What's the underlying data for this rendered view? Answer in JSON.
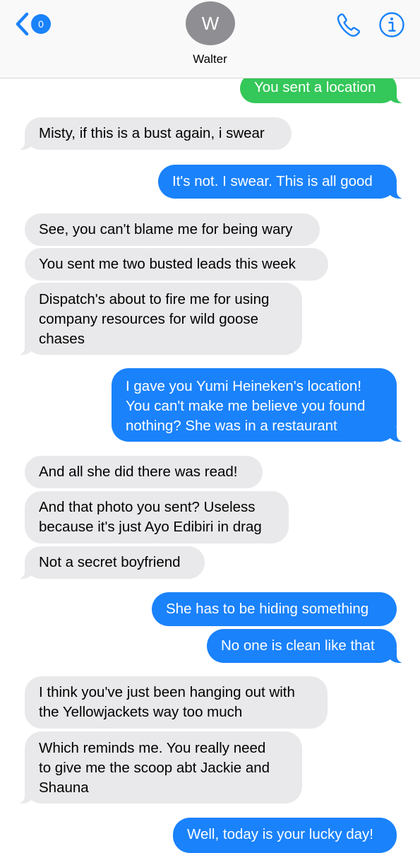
{
  "header": {
    "unread_count": "0",
    "avatar_initial": "W",
    "contact_name": "Walter",
    "back_icon": "chevron-left-icon",
    "call_icon": "phone-icon",
    "info_icon": "info-circle-icon"
  },
  "colors": {
    "accent": "#1a82fb",
    "sent_bubble": "#1a82fb",
    "received_bubble": "#e9e9eb",
    "location_bubble": "#34c759",
    "avatar": "#8e8e93"
  },
  "messages": [
    {
      "sender": "me",
      "text": "You sent a location"
    },
    {
      "sender": "walter",
      "text": "Misty, if this is a bust again, i swear"
    },
    {
      "sender": "me",
      "text": "It's not. I swear. This is all good"
    },
    {
      "sender": "walter",
      "text": "See, you can't blame me for being wary"
    },
    {
      "sender": "walter",
      "text": "You sent me two busted leads this week"
    },
    {
      "sender": "walter",
      "lines": [
        "Dispatch's about to fire me for using",
        "company resources for wild goose",
        "chases"
      ]
    },
    {
      "sender": "me",
      "lines": [
        "I gave you Yumi Heineken's location!",
        "You can't make me believe you found",
        "nothing? She was in a restaurant"
      ]
    },
    {
      "sender": "walter",
      "text": "And all she did there was read!"
    },
    {
      "sender": "walter",
      "lines": [
        "And that photo you sent? Useless",
        "because it's just Ayo Edibiri in drag"
      ]
    },
    {
      "sender": "walter",
      "text": "Not a secret boyfriend"
    },
    {
      "sender": "me",
      "text": "She has to be hiding something"
    },
    {
      "sender": "me",
      "text": "No one is clean like that"
    },
    {
      "sender": "walter",
      "lines": [
        "I think you've just been hanging out with",
        "the Yellowjackets way too much"
      ]
    },
    {
      "sender": "walter",
      "lines": [
        "Which reminds me. You really need",
        "to give me the scoop abt Jackie and",
        "Shauna"
      ]
    },
    {
      "sender": "me",
      "text": "Well, today is your lucky day!"
    }
  ]
}
